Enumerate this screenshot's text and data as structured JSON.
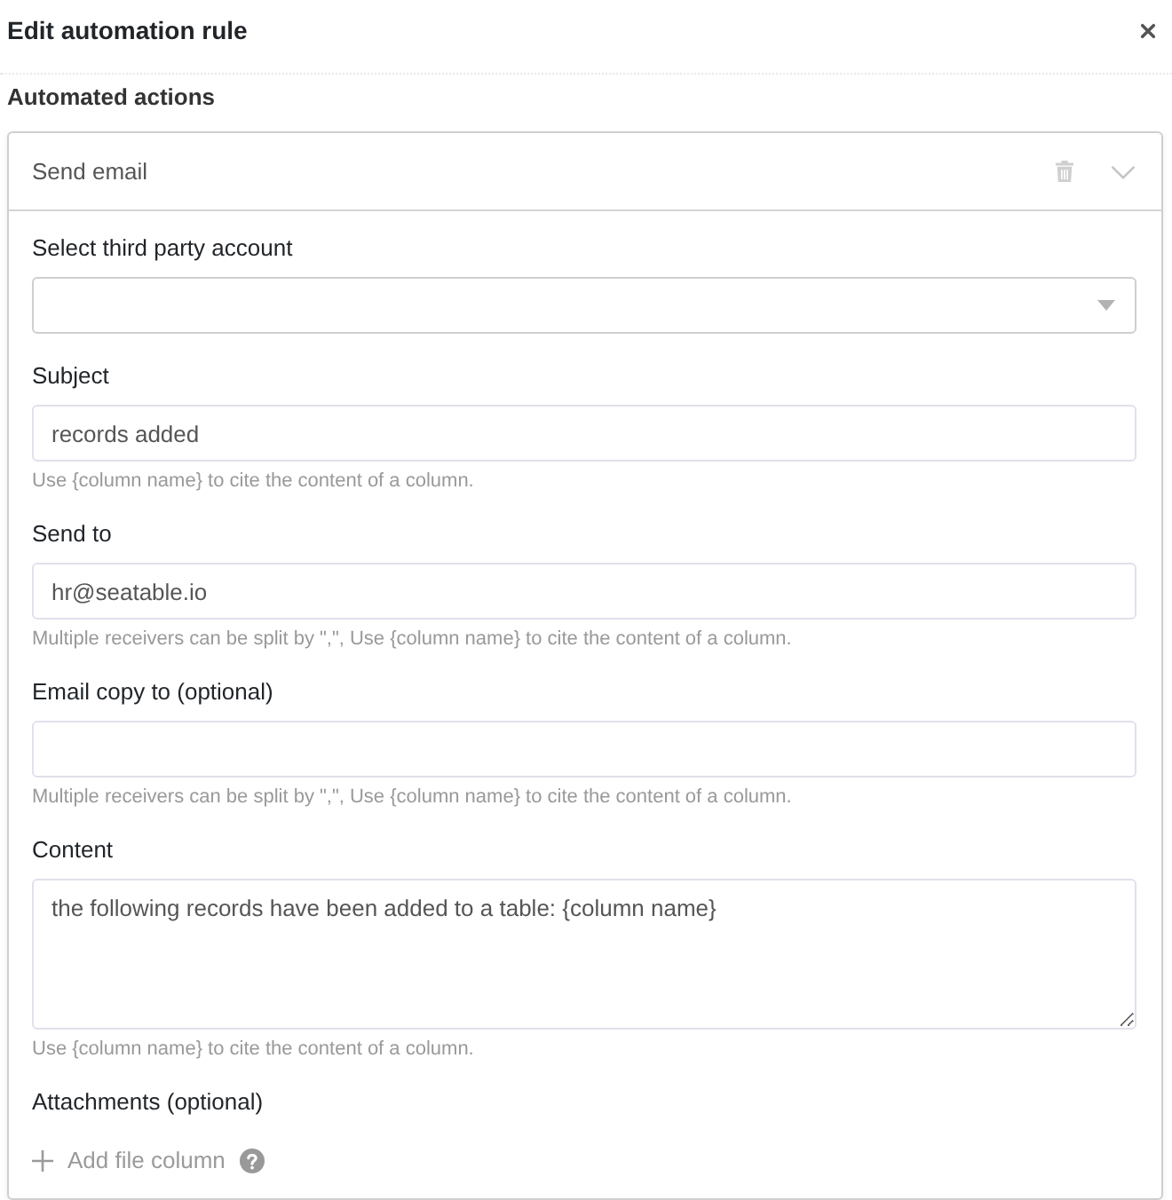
{
  "dialog": {
    "title": "Edit automation rule"
  },
  "section_title": "Automated actions",
  "action": {
    "title": "Send email",
    "fields": [
      {
        "kind": "select",
        "label": "Select third party account"
      },
      {
        "kind": "input",
        "label": "Subject",
        "value": "records added",
        "hint": "Use {column name} to cite the content of a column."
      },
      {
        "kind": "input",
        "label": "Send to",
        "value": "hr@seatable.io",
        "hint": "Multiple receivers can be split by \",\", Use {column name} to cite the content of a column."
      },
      {
        "kind": "input",
        "label": "Email copy to (optional)",
        "hint": "Multiple receivers can be split by \",\", Use {column name} to cite the content of a column."
      },
      {
        "kind": "textarea",
        "label": "Content",
        "value": "the following records have been added to a table: {column name}",
        "hint": "Use {column name} to cite the content of a column."
      },
      {
        "kind": "attachments",
        "label": "Attachments (optional)",
        "button": "Add file column"
      }
    ]
  }
}
